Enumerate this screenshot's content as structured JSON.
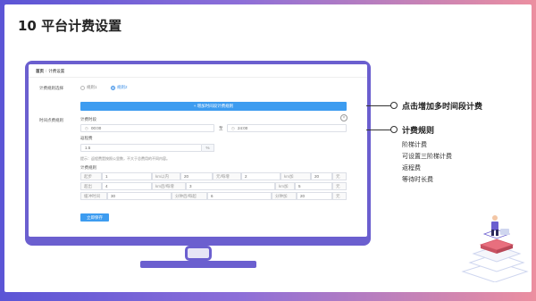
{
  "slide": {
    "title": "10 平台计费设置"
  },
  "screen": {
    "breadcrumb": [
      "首页",
      "计费设置"
    ],
    "rule_label": "计费规则选择",
    "rule_options": [
      {
        "label": "规则1",
        "selected": false
      },
      {
        "label": "规则2",
        "selected": true
      }
    ],
    "add_button_label": "+ 增加时间段计费规则",
    "period_label": "时间点费规则",
    "time_label": "计费时段",
    "start_time": "00:00",
    "to_label": "至",
    "end_time": "24:00",
    "range_label": "返程费",
    "range_value": "1.5",
    "range_suffix": "%",
    "hint": "提示：返程费是按照公里数，不大于总费用的不同内容。",
    "rules_label": "计费规则",
    "rows": [
      [
        {
          "k": "起步",
          "v": "1"
        },
        {
          "k": "km以内",
          "v": "20"
        },
        {
          "k": "元/每增",
          "v": "2"
        },
        {
          "k": "km加",
          "v": "20"
        },
        {
          "k": "元",
          "v": ""
        }
      ],
      [
        {
          "k": "超出",
          "v": "4"
        },
        {
          "k": "km后/每增",
          "v": "3"
        },
        {
          "k": "km加",
          "v": "5"
        },
        {
          "k": "元",
          "v": ""
        }
      ],
      [
        {
          "k": "缓冲时间",
          "v": "30"
        },
        {
          "k": "分钟后/每超",
          "v": "6"
        },
        {
          "k": "分钟加",
          "v": "20"
        },
        {
          "k": "元",
          "v": ""
        }
      ]
    ],
    "save_label": "立即保存"
  },
  "callouts": [
    {
      "text": "点击增加多时间段计费"
    },
    {
      "text": "计费规则"
    }
  ],
  "rule_list": [
    "阶梯计费",
    "可设置三阶梯计费",
    "返程费",
    "等待时长费"
  ],
  "colors": {
    "accent": "#6b5fcf",
    "button": "#3d9cf0",
    "gradient_start": "#5b55d6",
    "gradient_end": "#ec8fa0"
  }
}
